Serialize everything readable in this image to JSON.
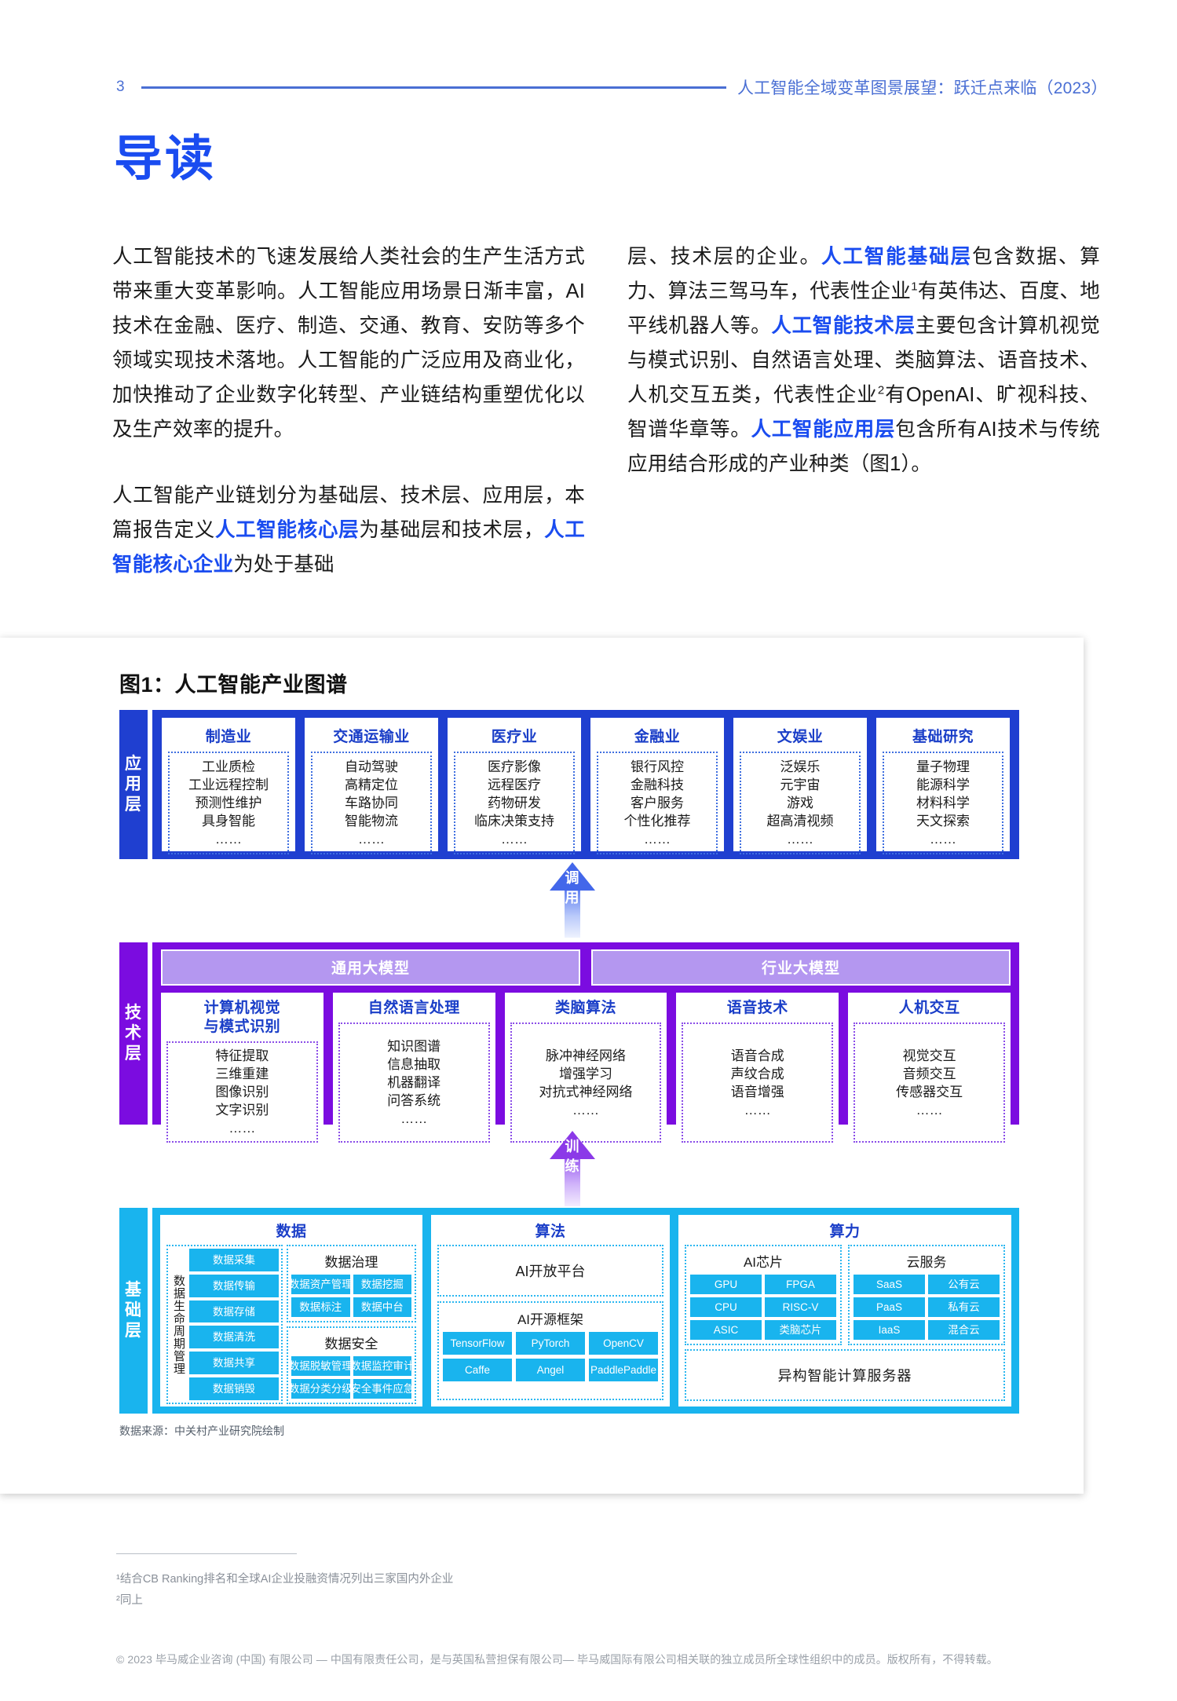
{
  "header": {
    "page_number": "3",
    "title": "人工智能全域变革图景展望：跃迁点来临（2023）"
  },
  "section": {
    "title": "导读"
  },
  "body": {
    "left": {
      "p1": "人工智能技术的飞速发展给人类社会的生产生活方式带来重大变革影响。人工智能应用场景日渐丰富，AI技术在金融、医疗、制造、交通、教育、安防等多个领域实现技术落地。人工智能的广泛应用及商业化，加快推动了企业数字化转型、产业链结构重塑优化以及生产效率的提升。",
      "p2_a": "人工智能产业链划分为基础层、技术层、应用层，本篇报告定义",
      "p2_hl1": "人工智能核心层",
      "p2_b": "为基础层和技术层，",
      "p2_hl2": "人工智能核心企业",
      "p2_c": "为处于基础"
    },
    "right": {
      "a": "层、技术层的企业。",
      "hl1": "人工智能基础层",
      "b": "包含数据、算力、算法三驾马车，代表性企业",
      "sup1": "1",
      "c": "有英伟达、百度、地平线机器人等。",
      "hl2": "人工智能技术层",
      "d": "主要包含计算机视觉与模式识别、自然语言处理、类脑算法、语音技术、人机交互五类，代表性企业",
      "sup2": "2",
      "e": "有OpenAI、旷视科技、智谱华章等。",
      "hl3": "人工智能应用层",
      "f": "包含所有AI技术与传统应用结合形成的产业种类（图1）。"
    }
  },
  "figure": {
    "title": "图1：人工智能产业图谱",
    "source": "数据来源：中关村产业研究院绘制",
    "application_layer": {
      "tab": [
        "应",
        "用",
        "层"
      ],
      "cards": [
        {
          "title": "制造业",
          "items": [
            "工业质检",
            "工业远程控制",
            "预测性维护",
            "具身智能",
            "……"
          ]
        },
        {
          "title": "交通运输业",
          "items": [
            "自动驾驶",
            "高精定位",
            "车路协同",
            "智能物流",
            "……"
          ]
        },
        {
          "title": "医疗业",
          "items": [
            "医疗影像",
            "远程医疗",
            "药物研发",
            "临床决策支持",
            "……"
          ]
        },
        {
          "title": "金融业",
          "items": [
            "银行风控",
            "金融科技",
            "客户服务",
            "个性化推荐",
            "……"
          ]
        },
        {
          "title": "文娱业",
          "items": [
            "泛娱乐",
            "元宇宙",
            "游戏",
            "超高清视频",
            "……"
          ]
        },
        {
          "title": "基础研究",
          "items": [
            "量子物理",
            "能源科学",
            "材料科学",
            "天文探索",
            "……"
          ]
        }
      ]
    },
    "arrow_call": {
      "label": [
        "调",
        "用"
      ]
    },
    "arrow_train": {
      "label": [
        "训",
        "练"
      ]
    },
    "technology_layer": {
      "tab": [
        "技",
        "术",
        "层"
      ],
      "model_bands": [
        "通用大模型",
        "行业大模型"
      ],
      "cards": [
        {
          "title": "计算机视觉\n与模式识别",
          "title_lines": [
            "计算机视觉",
            "与模式识别"
          ],
          "items": [
            "特征提取",
            "三维重建",
            "图像识别",
            "文字识别",
            "……"
          ]
        },
        {
          "title_lines": [
            "自然语言处理"
          ],
          "items": [
            "知识图谱",
            "信息抽取",
            "机器翻译",
            "问答系统",
            "……"
          ]
        },
        {
          "title_lines": [
            "类脑算法"
          ],
          "items": [
            "脉冲神经网络",
            "增强学习",
            "对抗式神经网络",
            "……"
          ]
        },
        {
          "title_lines": [
            "语音技术"
          ],
          "items": [
            "语音合成",
            "声纹合成",
            "语音增强",
            "……"
          ]
        },
        {
          "title_lines": [
            "人机交互"
          ],
          "items": [
            "视觉交互",
            "音频交互",
            "传感器交互",
            "……"
          ]
        }
      ]
    },
    "base_layer": {
      "tab": [
        "基",
        "础",
        "层"
      ],
      "data": {
        "title": "数据",
        "lifecycle_label": "数据生命周期管理",
        "lifecycle_chips": [
          "数据采集",
          "数据传输",
          "数据存储",
          "数据清洗",
          "数据共享",
          "数据销毁"
        ],
        "governance": {
          "title": "数据治理",
          "chips": [
            "数据资产管理",
            "数据挖掘",
            "数据标注",
            "数据中台"
          ]
        },
        "security": {
          "title": "数据安全",
          "chips": [
            "数据脱敏管理",
            "数据监控审计",
            "数据分类分级",
            "安全事件应急"
          ]
        }
      },
      "algorithm": {
        "title": "算法",
        "open_platform": "AI开放平台",
        "framework": {
          "title": "AI开源框架",
          "chips": [
            "TensorFlow",
            "PyTorch",
            "OpenCV",
            "Caffe",
            "Angel",
            "PaddlePaddle"
          ]
        }
      },
      "power": {
        "title": "算力",
        "chips_group": {
          "title": "AI芯片",
          "chips": [
            "GPU",
            "FPGA",
            "CPU",
            "RISC-V",
            "ASIC",
            "类脑芯片"
          ]
        },
        "cloud_group": {
          "title": "云服务",
          "chips": [
            "SaaS",
            "公有云",
            "PaaS",
            "私有云",
            "IaaS",
            "混合云"
          ]
        },
        "server": "异构智能计算服务器"
      }
    }
  },
  "footnotes": {
    "note1": "¹结合CB Ranking排名和全球AI企业投融资情况列出三家国内外企业",
    "note2": "²同上"
  },
  "copyright": "© 2023 毕马威企业咨询 (中国) 有限公司 — 中国有限责任公司，是与英国私营担保有限公司— 毕马威国际有限公司相关联的独立成员所全球性组织中的成员。版权所有，不得转载。",
  "colors": {
    "header_blue": "#4a6fd4",
    "title_blue": "#1a4cf0",
    "app_blue": "#1f3fd0",
    "tech_purple": "#7b0ce0",
    "base_cyan": "#19b4ee",
    "chip_cyan": "#19b4ee"
  }
}
